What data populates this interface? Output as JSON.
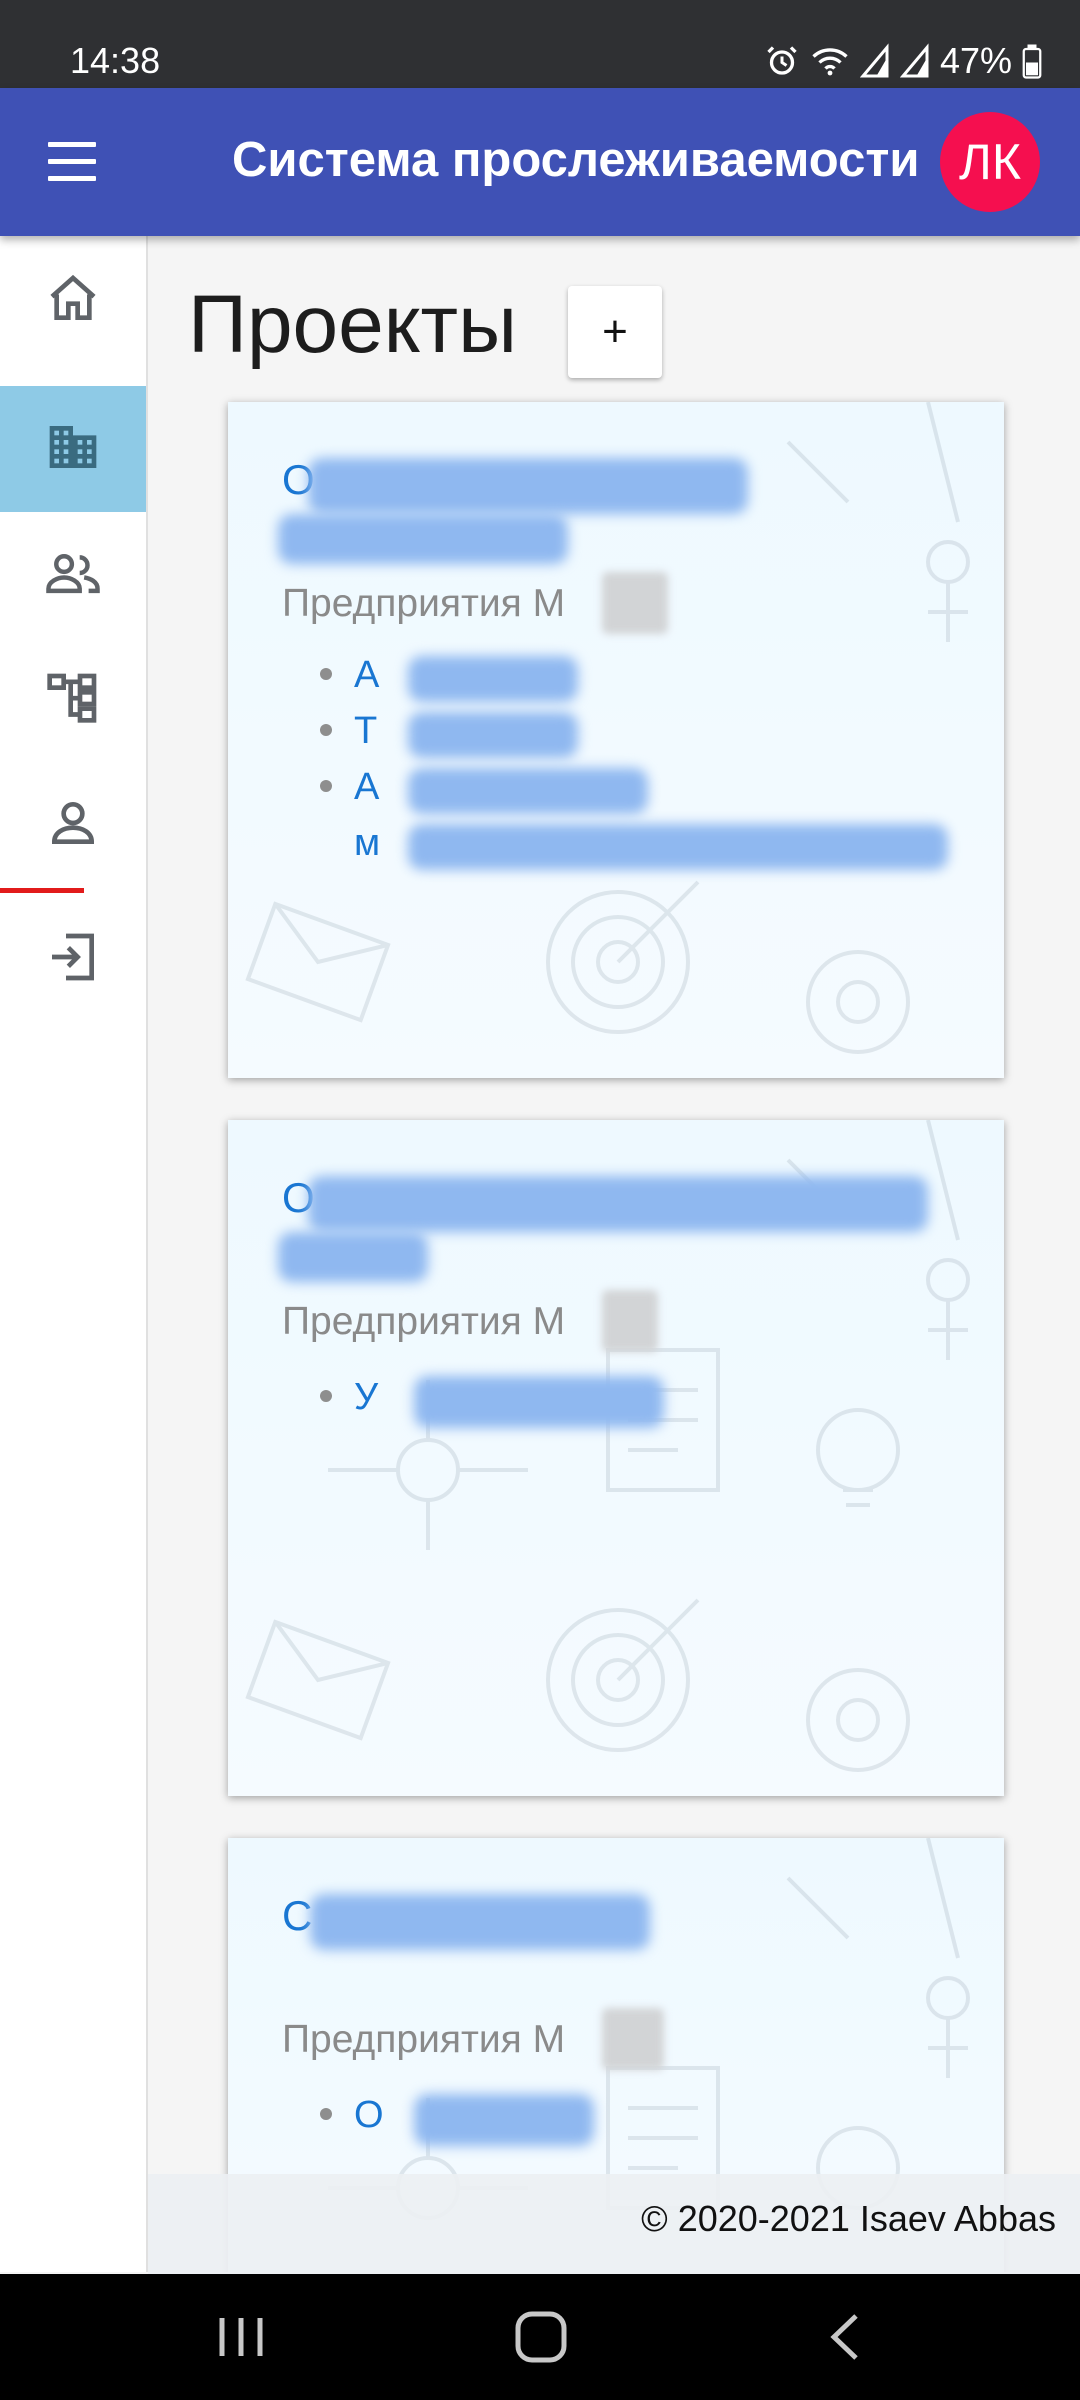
{
  "status_bar": {
    "time": "14:38",
    "battery": "47%",
    "icons": [
      "alarm-icon",
      "wifi-icon",
      "signal-icon",
      "signal-icon",
      "battery-icon"
    ]
  },
  "app_bar": {
    "title": "Система прослеживаемости",
    "avatar_initials": "ЛК",
    "colors": {
      "app_bar": "#3f51b5",
      "avatar": "#f50f4f"
    }
  },
  "sidebar": {
    "items": [
      {
        "icon": "home-icon",
        "active": false
      },
      {
        "icon": "business-icon",
        "active": true
      },
      {
        "icon": "people-icon",
        "active": false
      },
      {
        "icon": "schema-icon",
        "active": false
      },
      {
        "icon": "person-icon",
        "active": false
      },
      {
        "icon": "logout-icon",
        "active": false
      }
    ],
    "active_color": "#8ecae6"
  },
  "main": {
    "page_title": "Проекты",
    "add_label": "+",
    "cards": [
      {
        "title_initial": "О",
        "subtitle": "Предприятия М",
        "items": [
          "А",
          "Т",
          "А",
          "м"
        ]
      },
      {
        "title_initial": "О",
        "subtitle": "Предприятия М",
        "items": [
          "У"
        ]
      },
      {
        "title_initial": "С",
        "subtitle": "Предприятия М",
        "items": [
          "О"
        ]
      }
    ]
  },
  "footer": {
    "text": "© 2020-2021 Isaev Abbas"
  },
  "nav_bar": {
    "icons": [
      "recents-icon",
      "home-button-icon",
      "back-icon"
    ]
  }
}
